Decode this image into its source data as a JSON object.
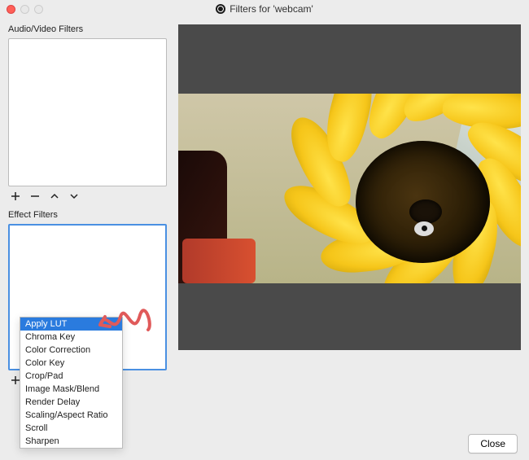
{
  "window": {
    "title": "Filters for 'webcam'"
  },
  "left": {
    "av_label": "Audio/Video Filters",
    "effect_label": "Effect Filters",
    "toolbar": {
      "add": "+",
      "remove": "−",
      "up": "▴",
      "down": "▾"
    }
  },
  "dropdown": {
    "items": [
      "Apply LUT",
      "Chroma Key",
      "Color Correction",
      "Color Key",
      "Crop/Pad",
      "Image Mask/Blend",
      "Render Delay",
      "Scaling/Aspect Ratio",
      "Scroll",
      "Sharpen"
    ],
    "selected_index": 0
  },
  "buttons": {
    "close": "Close"
  }
}
